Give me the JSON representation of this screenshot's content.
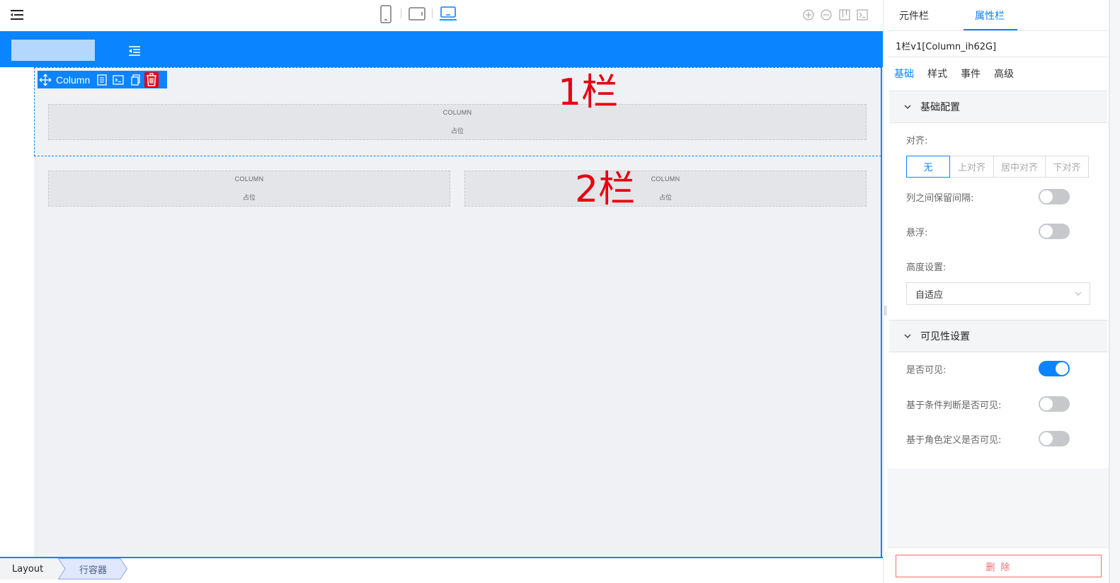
{
  "viewport": {
    "devices": [
      "mobile",
      "tablet",
      "desktop"
    ],
    "active": "desktop"
  },
  "toolbar_icons": [
    "zoom-in-icon",
    "zoom-out-icon",
    "layout-icon",
    "terminal-icon"
  ],
  "canvas": {
    "selected_toolbar_label": "Column",
    "row1": {
      "columns": [
        {
          "title": "COLUMN",
          "sub": "占位"
        }
      ],
      "annotation": "1栏"
    },
    "row2": {
      "columns": [
        {
          "title": "COLUMN",
          "sub": "占位"
        },
        {
          "title": "COLUMN",
          "sub": "占位"
        }
      ],
      "annotation": "2栏"
    }
  },
  "breadcrumb": [
    "Layout",
    "行容器"
  ],
  "panel": {
    "tabs": [
      "元件栏",
      "属性栏"
    ],
    "active_tab": "属性栏",
    "component_title": "1栏v1[Column_ih62G]",
    "sub_tabs": [
      "基础",
      "样式",
      "事件",
      "高级"
    ],
    "active_sub_tab": "基础",
    "basic_section": {
      "title": "基础配置",
      "align_label": "对齐:",
      "align_options": [
        "无",
        "上对齐",
        "居中对齐",
        "下对齐"
      ],
      "align_selected": "无",
      "gap_label": "列之间保留间隔:",
      "gap_on": false,
      "float_label": "悬浮:",
      "float_on": false,
      "height_label": "高度设置:",
      "height_value": "自适应"
    },
    "visibility_section": {
      "title": "可见性设置",
      "visible_label": "是否可见:",
      "visible_on": true,
      "cond_label": "基于条件判断是否可见:",
      "cond_on": false,
      "role_label": "基于角色定义是否可见:",
      "role_on": false
    },
    "delete_label": "删 除"
  },
  "colors": {
    "accent": "#0a84ff",
    "danger": "#e60012",
    "delete": "#f56c6c"
  }
}
